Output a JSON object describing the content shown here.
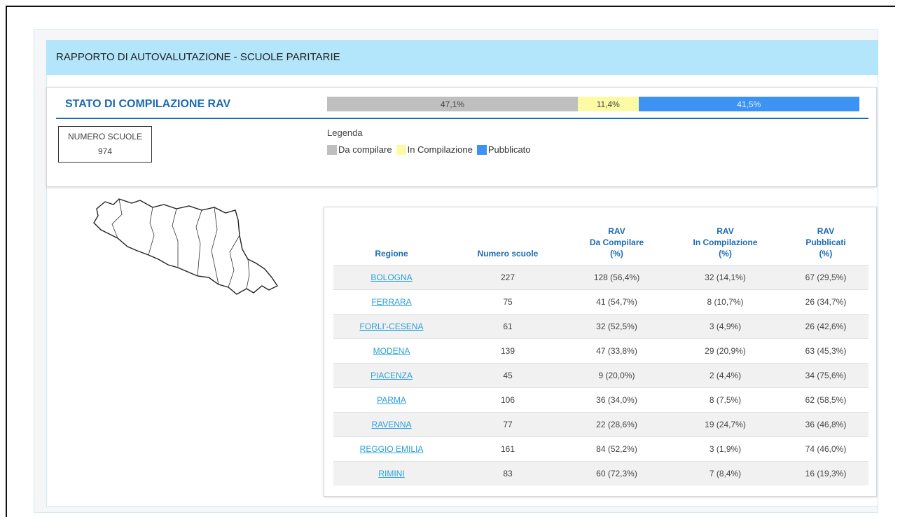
{
  "page_title": "RAPPORTO DI AUTOVALUTAZIONE - SCUOLE PARITARIE",
  "status": {
    "title": "STATO DI COMPILAZIONE RAV",
    "bar": [
      {
        "label": "47,1%",
        "value": 47.1,
        "color": "#bfbfbf"
      },
      {
        "label": "11,4%",
        "value": 11.4,
        "color": "#fdfaa6"
      },
      {
        "label": "41,5%",
        "value": 41.5,
        "color": "#3d93f4"
      }
    ],
    "num_schools_label": "NUMERO SCUOLE",
    "num_schools_value": "974",
    "legend_title": "Legenda",
    "legend": [
      {
        "label": "Da compilare",
        "color": "#bfbfbf"
      },
      {
        "label": "In Compilazione",
        "color": "#fdfaa6"
      },
      {
        "label": "Pubblicato",
        "color": "#3d93f4"
      }
    ]
  },
  "table": {
    "headers": [
      [
        "Regione"
      ],
      [
        "Numero scuole"
      ],
      [
        "RAV",
        "Da Compilare",
        "(%)"
      ],
      [
        "RAV",
        "In Compilazione",
        "(%)"
      ],
      [
        "RAV",
        "Pubblicati",
        "(%)"
      ]
    ],
    "rows": [
      [
        "BOLOGNA",
        "227",
        "128 (56,4%)",
        "32 (14,1%)",
        "67 (29,5%)"
      ],
      [
        "FERRARA",
        "75",
        "41 (54,7%)",
        "8 (10,7%)",
        "26 (34,7%)"
      ],
      [
        "FORLI'-CESENA",
        "61",
        "32 (52,5%)",
        "3 (4,9%)",
        "26 (42,6%)"
      ],
      [
        "MODENA",
        "139",
        "47 (33,8%)",
        "29 (20,9%)",
        "63 (45,3%)"
      ],
      [
        "PIACENZA",
        "45",
        "9 (20,0%)",
        "2 (4,4%)",
        "34 (75,6%)"
      ],
      [
        "PARMA",
        "106",
        "36 (34,0%)",
        "8 (7,5%)",
        "62 (58,5%)"
      ],
      [
        "RAVENNA",
        "77",
        "22 (28,6%)",
        "19 (24,7%)",
        "36 (46,8%)"
      ],
      [
        "REGGIO EMILIA",
        "161",
        "84 (52,2%)",
        "3 (1,9%)",
        "74 (46,0%)"
      ],
      [
        "RIMINI",
        "83",
        "60 (72,3%)",
        "7 (8,4%)",
        "16 (19,3%)"
      ]
    ]
  }
}
